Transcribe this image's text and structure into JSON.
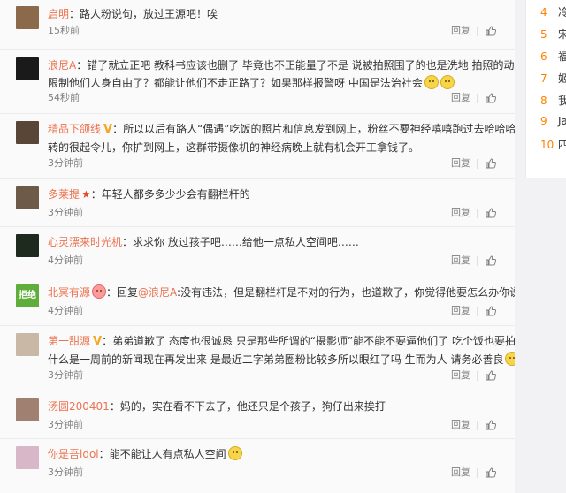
{
  "actions": {
    "reply_label": "回复"
  },
  "comments": [
    {
      "user": "启明",
      "sep": "：",
      "lines": [
        "路人粉说句，放过王源吧！唉"
      ],
      "time": "15秒前",
      "avatar_color": "#8a6a4a",
      "emoji": 0
    },
    {
      "user": "浪尼A",
      "sep": "：",
      "lines": [
        "错了就立正吧 教科书应该也删了 毕竟也不正能量了不是 说被拍照围了的也是洗地 拍照的动手啦？",
        "限制他们人身自由了？都能让他们不走正路了？如果那样报警呀 中国是法治社会"
      ],
      "time": "54秒前",
      "avatar_color": "#1a1a1a",
      "emoji": 2
    },
    {
      "user": "精品下颌线",
      "badge": "V",
      "sep": "：",
      "lines": [
        "所以以后有路人“偶遇”吃饭的照片和信息发到网上，粉丝不要神经嘻嘻跑过去哈哈哈哈哈还",
        "转的很起令儿，你扩到网上，这群带摄像机的神经病晚上就有机会开工拿钱了。"
      ],
      "time": "3分钟前",
      "avatar_color": "#5a4636",
      "emoji": 0
    },
    {
      "user": "多莱提",
      "star": "★",
      "sep": "：",
      "lines": [
        "年轻人都多多少少会有翻栏杆的"
      ],
      "time": "3分钟前",
      "avatar_color": "#6e5a48",
      "emoji": 0
    },
    {
      "user": "心灵漂来时光机",
      "sep": "：",
      "lines": [
        "求求你 放过孩子吧……给他一点私人空间吧……"
      ],
      "time": "4分钟前",
      "avatar_color": "#1f2a1f",
      "emoji": 0
    },
    {
      "user": "北冥有源",
      "sep": "：",
      "reply_prefix": "回复",
      "mention": "@浪尼A",
      "lines": [
        ":没有违法，但是翻栏杆是不对的行为，也道歉了，你觉得他要怎么办你说呗"
      ],
      "time": "4分钟前",
      "avatar_color": "#5fae3c",
      "avatar_text": "拒绝",
      "emoji": 0,
      "face_after_user": true
    },
    {
      "user": "第一甜源",
      "badge": "V",
      "sep": "：",
      "lines": [
        "弟弟道歉了 态度也很诚恳 只是那些所谓的“摄影师”能不能不要逼他们了 吃个饭也要拍 而且为",
        "什么是一周前的新闻现在再发出来 是最近二字弟弟圈粉比较多所以眼红了吗 生而为人 请务必善良"
      ],
      "time": "3分钟前",
      "avatar_color": "#c9b8a6",
      "emoji": 1
    },
    {
      "user": "汤圆200401",
      "sep": "：",
      "lines": [
        "妈的，实在看不下去了，他还只是个孩子，狗仔出来挨打"
      ],
      "time": "3分钟前",
      "avatar_color": "#a08070",
      "emoji": 0
    },
    {
      "user": "你是吾idol",
      "sep": "：",
      "lines": [
        "能不能让人有点私人空间"
      ],
      "time": "3分钟前",
      "avatar_color": "#d8b8c8",
      "emoji": 1
    }
  ],
  "sidebar": {
    "items": [
      {
        "num": "4",
        "text": "冷"
      },
      {
        "num": "5",
        "text": "宋"
      },
      {
        "num": "6",
        "text": "福"
      },
      {
        "num": "7",
        "text": "姬"
      },
      {
        "num": "8",
        "text": "我"
      },
      {
        "num": "9",
        "text": "Ja"
      },
      {
        "num": "10",
        "text": "四"
      }
    ]
  }
}
